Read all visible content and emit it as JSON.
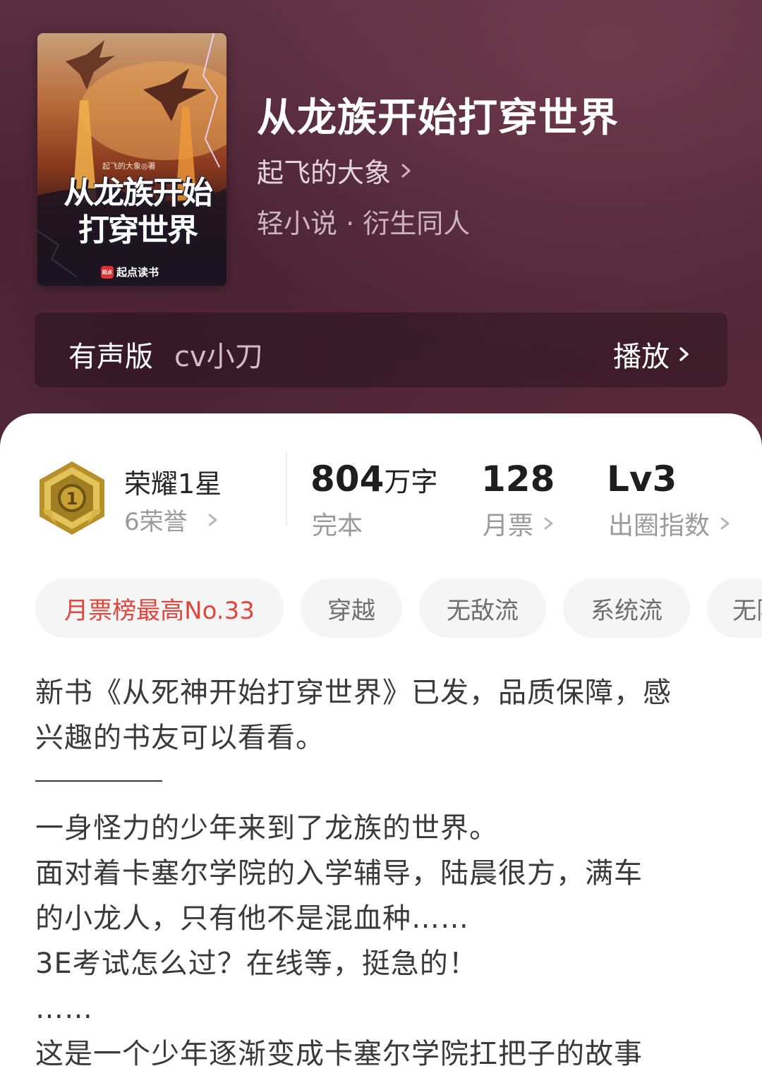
{
  "book": {
    "title": "从龙族开始打穿世界",
    "author": "起飞的大象",
    "category": "轻小说 · 衍生同人",
    "cover": {
      "author_credit": "起飞的大象◎著",
      "title_line1": "从龙族开始",
      "title_line2": "打穿世界",
      "brand": "起点读书",
      "brand_logo": "起点"
    }
  },
  "audio": {
    "label": "有声版",
    "narrator": "cv小刀",
    "play_label": "播放"
  },
  "stats": {
    "honor_title": "荣耀1星",
    "honor_sub": "6荣誉",
    "word_count_num": "804",
    "word_count_unit": "万字",
    "word_count_label": "完本",
    "monthly_votes": "128",
    "monthly_votes_label": "月票",
    "level": "Lv3",
    "level_label": "出圈指数"
  },
  "tags": [
    "月票榜最高No.33",
    "穿越",
    "无敌流",
    "系统流",
    "无限流"
  ],
  "description": {
    "line1": "新书《从死神开始打穿世界》已发，品质保障，感",
    "line2": "兴趣的书友可以看看。",
    "line3": "一身怪力的少年来到了龙族的世界。",
    "line4": "面对着卡塞尔学院的入学辅导，陆晨很方，满车",
    "line5": "的小龙人，只有他不是混血种……",
    "line6": "3E考试怎么过？在线等，挺急的！",
    "line7": "……",
    "line8": "这是一个少年逐渐变成卡塞尔学院扛把子的故事"
  },
  "colors": {
    "hero_bg": "#4c2535",
    "accent_red": "#e0463c",
    "tag_bg": "#f5f5f5",
    "badge_gold": "#c9a233"
  }
}
